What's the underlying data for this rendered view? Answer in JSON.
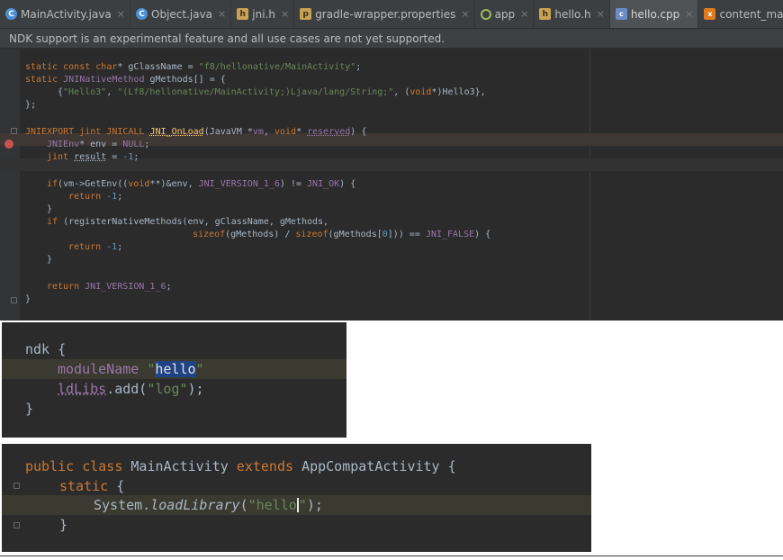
{
  "tabs": [
    {
      "label": "MainActivity.java",
      "icon": "class-icon",
      "glyph": "C"
    },
    {
      "label": "Object.java",
      "icon": "class-icon",
      "glyph": "C"
    },
    {
      "label": "jni.h",
      "icon": "header-file-icon",
      "glyph": "h"
    },
    {
      "label": "gradle-wrapper.properties",
      "icon": "properties-file-icon",
      "glyph": "p"
    },
    {
      "label": "app",
      "icon": "gradle-module-icon",
      "glyph": ""
    },
    {
      "label": "hello.h",
      "icon": "header-file-icon",
      "glyph": "h"
    },
    {
      "label": "hello.cpp",
      "icon": "cpp-file-icon",
      "glyph": "c"
    },
    {
      "label": "content_main.xml",
      "icon": "xml-file-icon",
      "glyph": "x"
    }
  ],
  "active_tab": "hello.cpp",
  "close_glyph": "×",
  "notice": "NDK support is an experimental feature and all use cases are not yet supported.",
  "panel1": {
    "l1": [
      "static const ",
      "char",
      "* gClassName = ",
      "\"f8/hellonative/MainActivity\"",
      ";"
    ],
    "l2": [
      "static ",
      "JNINativeMethod",
      " gMethods[] = {"
    ],
    "l3": [
      "{",
      "\"Hello3\"",
      ", ",
      "\"(Lf8/hellonative/MainActivity;)Ljava/lang/String;\"",
      ", (",
      "void",
      "*)Hello3},"
    ],
    "l4": "};",
    "l5": [
      "JNIEXPORT jint JNICALL ",
      "JNI_OnLoad",
      "(JavaVM *",
      "vm",
      ", ",
      "void",
      "* ",
      "reserved",
      ") {"
    ],
    "l6": [
      "JNIEnv",
      "* env = ",
      "NULL",
      ";"
    ],
    "l7": [
      "jint ",
      "result",
      " = ",
      "-1",
      ";"
    ],
    "l8": [
      "if",
      "(vm->GetEnv((",
      "void",
      "**)&env, ",
      "JNI_VERSION_1_6",
      ") != ",
      "JNI_OK",
      ") {"
    ],
    "l9": [
      "return ",
      "-1",
      ";"
    ],
    "l10": "}",
    "l11": [
      "if",
      " (registerNativeMethods(env, gClassName, gMethods,"
    ],
    "l12": [
      "sizeof",
      "(gMethods) / ",
      "sizeof",
      "(gMethods[",
      "0",
      "])) == ",
      "JNI_FALSE",
      ") {"
    ],
    "l13": [
      "return ",
      "-1",
      ";"
    ],
    "l14": "}",
    "l15": [
      "return ",
      "JNI_VERSION_1_6",
      ";"
    ],
    "l16": "}"
  },
  "panel2": {
    "l1": [
      "ndk",
      " {"
    ],
    "l2": [
      "moduleName ",
      "\"",
      "hello",
      "\""
    ],
    "l3": [
      "ldLibs",
      ".add(",
      "\"log\"",
      ");"
    ],
    "l4": "}"
  },
  "panel3": {
    "l1": [
      "public class ",
      "MainActivity",
      " extends ",
      "AppCompatActivity",
      " {"
    ],
    "l2": [
      "static",
      " {"
    ],
    "l3": [
      "System.",
      "loadLibrary",
      "(",
      "\"hello",
      "\"",
      ");"
    ],
    "l4": "}"
  }
}
